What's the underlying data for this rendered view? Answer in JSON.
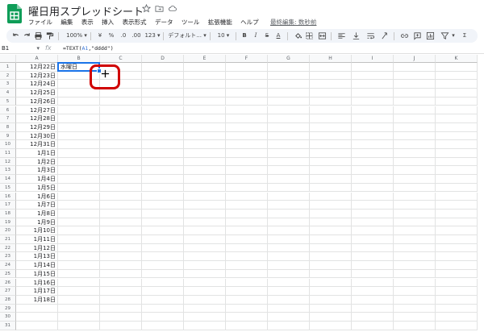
{
  "doc": {
    "title": "曜日用スプレッドシート",
    "last_edit": "最終編集: 数秒前"
  },
  "menu": [
    "ファイル",
    "編集",
    "表示",
    "挿入",
    "表示形式",
    "データ",
    "ツール",
    "拡張機能",
    "ヘルプ"
  ],
  "toolbar": {
    "zoom": "100%",
    "currency": "¥",
    "percent": "%",
    "dec_decrease": ".0",
    "dec_increase": ".00",
    "more_formats": "123",
    "font": "デフォルト...",
    "font_size": "10",
    "bold": "B",
    "italic": "I",
    "strike": "S",
    "text_color": "A"
  },
  "formula_bar": {
    "cell_ref": "B1",
    "fx": "fx",
    "formula_prefix": "=TEXT(",
    "formula_ref": "A1",
    "formula_suffix": ",\"dddd\")"
  },
  "columns": [
    "A",
    "B",
    "C",
    "D",
    "E",
    "F",
    "G",
    "H",
    "I",
    "J",
    "K"
  ],
  "rows": [
    {
      "n": "1",
      "a": "12月22日",
      "b": "水曜日"
    },
    {
      "n": "2",
      "a": "12月23日",
      "b": ""
    },
    {
      "n": "3",
      "a": "12月24日",
      "b": ""
    },
    {
      "n": "4",
      "a": "12月25日",
      "b": ""
    },
    {
      "n": "5",
      "a": "12月26日",
      "b": ""
    },
    {
      "n": "6",
      "a": "12月27日",
      "b": ""
    },
    {
      "n": "7",
      "a": "12月28日",
      "b": ""
    },
    {
      "n": "8",
      "a": "12月29日",
      "b": ""
    },
    {
      "n": "9",
      "a": "12月30日",
      "b": ""
    },
    {
      "n": "10",
      "a": "12月31日",
      "b": ""
    },
    {
      "n": "11",
      "a": "1月1日",
      "b": ""
    },
    {
      "n": "12",
      "a": "1月2日",
      "b": ""
    },
    {
      "n": "13",
      "a": "1月3日",
      "b": ""
    },
    {
      "n": "14",
      "a": "1月4日",
      "b": ""
    },
    {
      "n": "15",
      "a": "1月5日",
      "b": ""
    },
    {
      "n": "16",
      "a": "1月6日",
      "b": ""
    },
    {
      "n": "17",
      "a": "1月7日",
      "b": ""
    },
    {
      "n": "18",
      "a": "1月8日",
      "b": ""
    },
    {
      "n": "19",
      "a": "1月9日",
      "b": ""
    },
    {
      "n": "20",
      "a": "1月10日",
      "b": ""
    },
    {
      "n": "21",
      "a": "1月11日",
      "b": ""
    },
    {
      "n": "22",
      "a": "1月12日",
      "b": ""
    },
    {
      "n": "23",
      "a": "1月13日",
      "b": ""
    },
    {
      "n": "24",
      "a": "1月14日",
      "b": ""
    },
    {
      "n": "25",
      "a": "1月15日",
      "b": ""
    },
    {
      "n": "26",
      "a": "1月16日",
      "b": ""
    },
    {
      "n": "27",
      "a": "1月17日",
      "b": ""
    },
    {
      "n": "28",
      "a": "1月18日",
      "b": ""
    },
    {
      "n": "29",
      "a": "",
      "b": ""
    },
    {
      "n": "30",
      "a": "",
      "b": ""
    },
    {
      "n": "31",
      "a": "",
      "b": ""
    }
  ],
  "colors": {
    "accent": "#1a73e8",
    "callout": "#d00000",
    "logo": "#0f9d58"
  }
}
